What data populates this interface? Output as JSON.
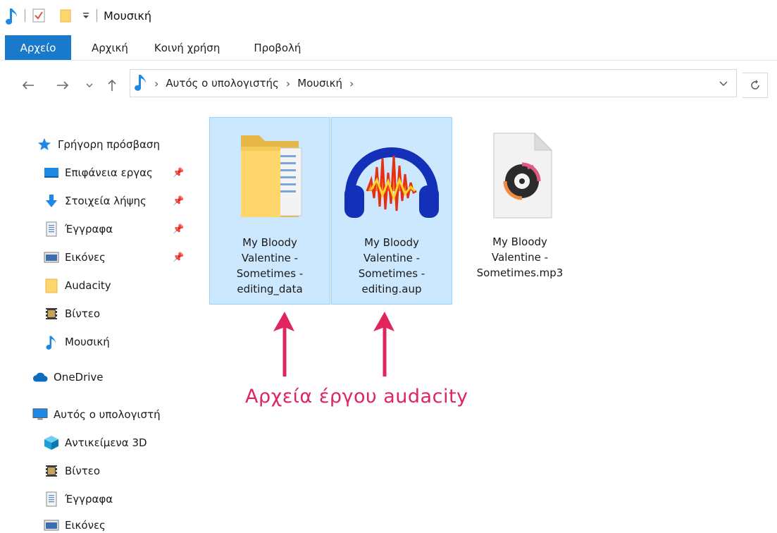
{
  "window": {
    "title": "Μουσική"
  },
  "ribbon": {
    "tabs": [
      "Αρχείο",
      "Αρχική",
      "Κοινή χρήση",
      "Προβολή"
    ]
  },
  "address_bar": {
    "crumbs": [
      "Αυτός ο υπολογιστής",
      "Μουσική"
    ]
  },
  "sidebar": {
    "quick_access": "Γρήγορη πρόσβαση",
    "items": [
      {
        "label": "Επιφάνεια εργας",
        "icon": "desktop-icon",
        "pinned": true
      },
      {
        "label": "Στοιχεία λήψης",
        "icon": "download-icon",
        "pinned": true
      },
      {
        "label": "Έγγραφα",
        "icon": "documents-icon",
        "pinned": true
      },
      {
        "label": "Εικόνες",
        "icon": "pictures-icon",
        "pinned": true
      },
      {
        "label": "Audacity",
        "icon": "folder-icon",
        "pinned": false
      },
      {
        "label": "Βίντεο",
        "icon": "videos-icon",
        "pinned": false
      },
      {
        "label": "Μουσική",
        "icon": "music-icon",
        "pinned": false
      }
    ],
    "onedrive": "OneDrive",
    "this_pc": "Αυτός ο υπολογιστή",
    "pc_items": [
      {
        "label": "Αντικείμενα 3D",
        "icon": "3d-objects-icon"
      },
      {
        "label": "Βίντεο",
        "icon": "videos-icon"
      },
      {
        "label": "Έγγραφα",
        "icon": "documents-icon"
      },
      {
        "label": "Εικόνες",
        "icon": "pictures-icon"
      }
    ]
  },
  "files": [
    {
      "line1": "My Bloody",
      "line2": "Valentine -",
      "line3": "Sometimes -",
      "line4": "editing_data",
      "icon": "folder-icon",
      "selected": true
    },
    {
      "line1": "My Bloody",
      "line2": "Valentine -",
      "line3": "Sometimes -",
      "line4": "editing.aup",
      "icon": "audacity-icon",
      "selected": true
    },
    {
      "line1": "My Bloody",
      "line2": "Valentine -",
      "line3": "Sometimes.mp3",
      "line4": "",
      "icon": "mp3-file-icon",
      "selected": false
    }
  ],
  "annotation": {
    "text": "Αρχεία έργου audacity",
    "color": "#e0245e"
  },
  "colors": {
    "accent": "#1979ca",
    "selection": "#cce8ff",
    "selection_border": "#99d1ff"
  }
}
